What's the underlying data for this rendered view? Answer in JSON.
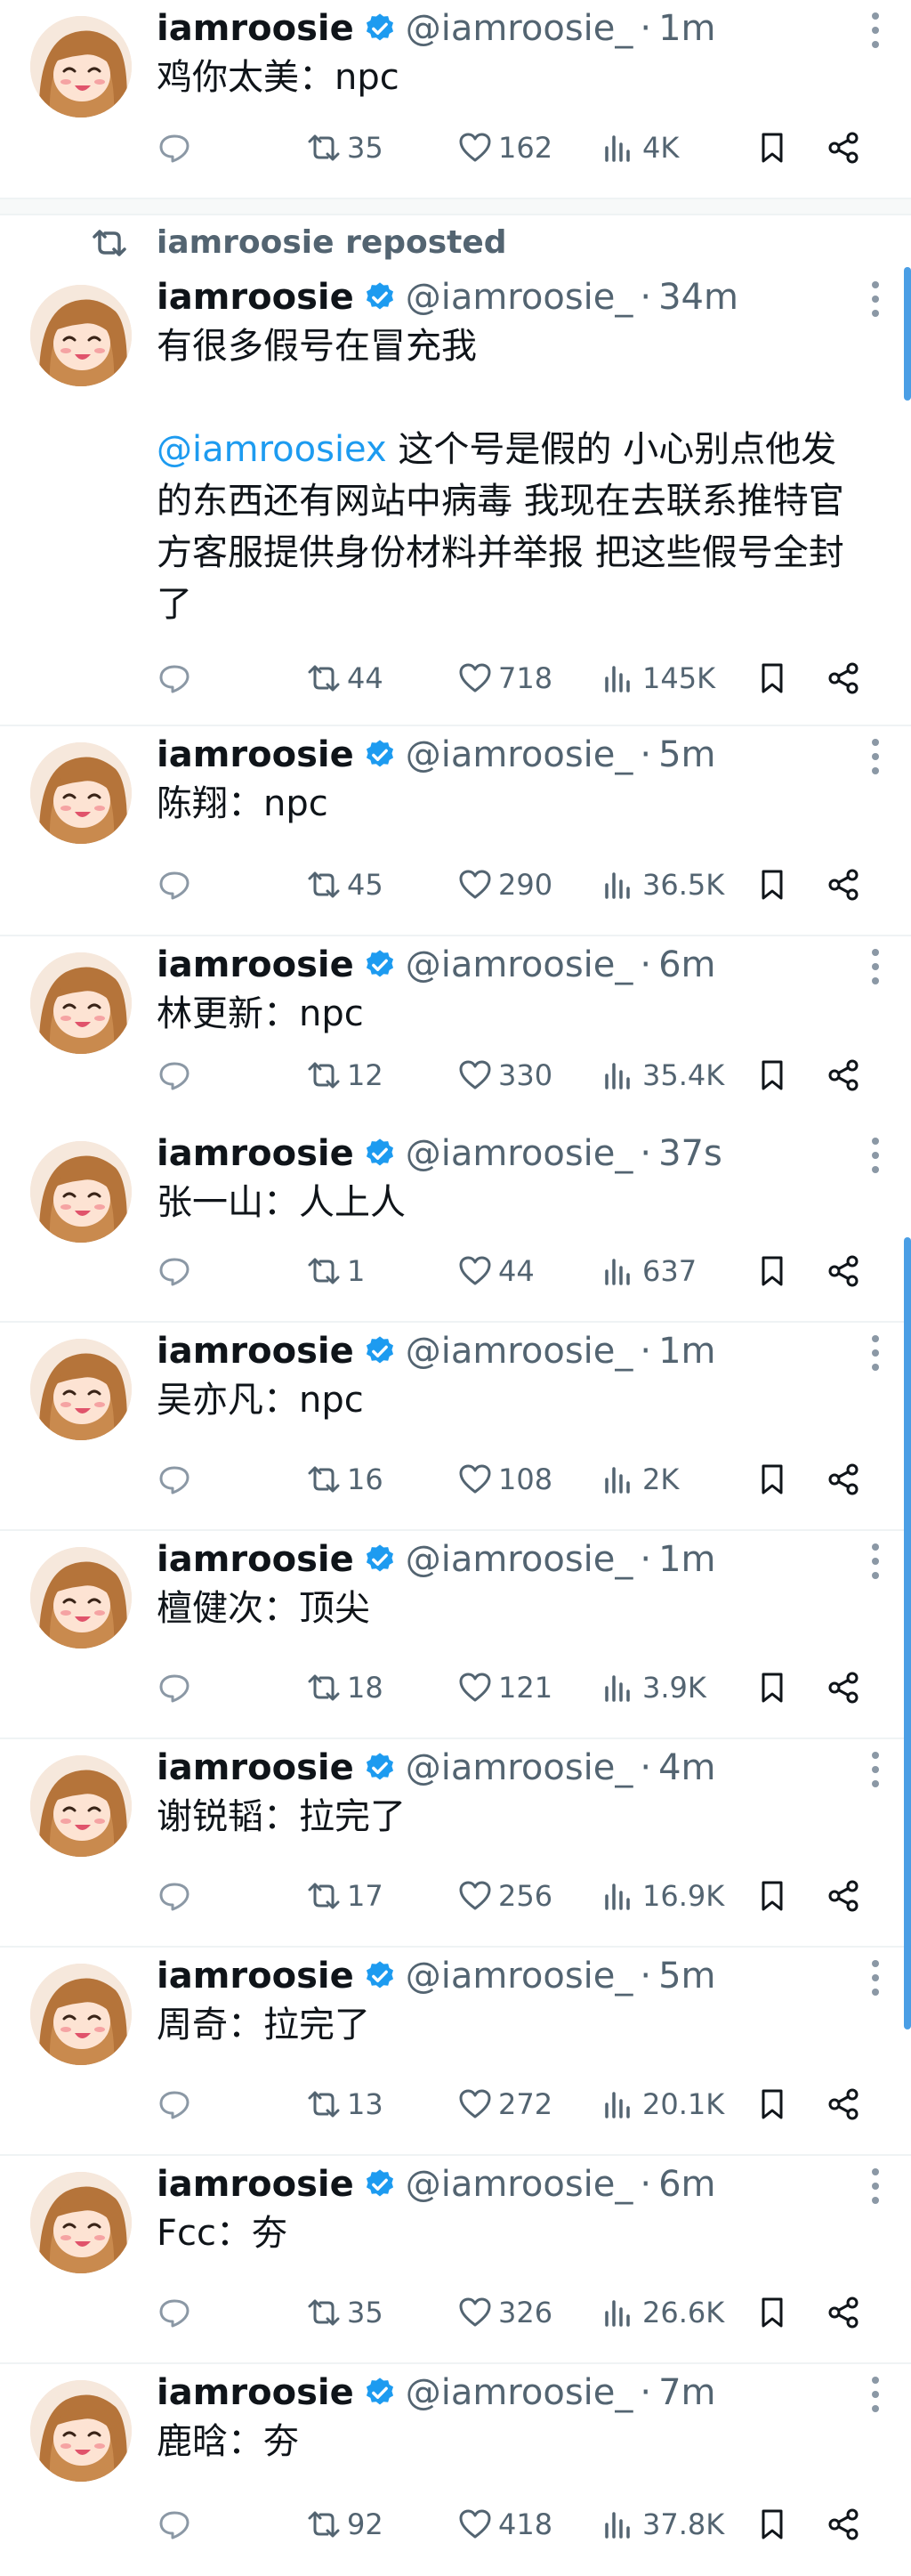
{
  "account": {
    "name": "iamroosie",
    "handle": "@iamroosie_",
    "dot": "·"
  },
  "repost_banner": {
    "text": "iamroosie reposted"
  },
  "colors": {
    "accent": "#1d9bf0",
    "muted": "#536471",
    "verified": "#1d9bf0"
  },
  "icons": {
    "reply": "reply-icon",
    "repost": "repost-icon",
    "like": "heart-icon",
    "views": "views-icon",
    "bookmark": "bookmark-icon",
    "share": "share-icon",
    "more": "more-icon",
    "verified": "verified-badge-icon"
  },
  "tweets": [
    {
      "time": "1m",
      "text": "鸡你太美：npc",
      "reposts": "35",
      "likes": "162",
      "views": "4K"
    },
    {
      "time": "34m",
      "text": "有很多假号在冒充我",
      "mention": "@iamroosiex",
      "text2": " 这个号是假的 小心别点他发的东西还有网站中病毒 我现在去联系推特官方客服提供身份材料并举报 把这些假号全封了",
      "reposts": "44",
      "likes": "718",
      "views": "145K"
    },
    {
      "time": "5m",
      "text": "陈翔：npc",
      "reposts": "45",
      "likes": "290",
      "views": "36.5K"
    },
    {
      "time": "6m",
      "text": "林更新：npc",
      "reposts": "12",
      "likes": "330",
      "views": "35.4K"
    },
    {
      "time": "37s",
      "text": "张一山：人上人",
      "reposts": "1",
      "likes": "44",
      "views": "637"
    },
    {
      "time": "1m",
      "text": "吴亦凡：npc",
      "reposts": "16",
      "likes": "108",
      "views": "2K"
    },
    {
      "time": "1m",
      "text": "檀健次：顶尖",
      "reposts": "18",
      "likes": "121",
      "views": "3.9K"
    },
    {
      "time": "4m",
      "text": "谢锐韬：拉完了",
      "reposts": "17",
      "likes": "256",
      "views": "16.9K"
    },
    {
      "time": "5m",
      "text": "周奇：拉完了",
      "reposts": "13",
      "likes": "272",
      "views": "20.1K"
    },
    {
      "time": "6m",
      "text": "Fcc：夯",
      "reposts": "35",
      "likes": "326",
      "views": "26.6K"
    },
    {
      "time": "7m",
      "text": "鹿晗：夯",
      "reposts": "92",
      "likes": "418",
      "views": "37.8K"
    }
  ]
}
